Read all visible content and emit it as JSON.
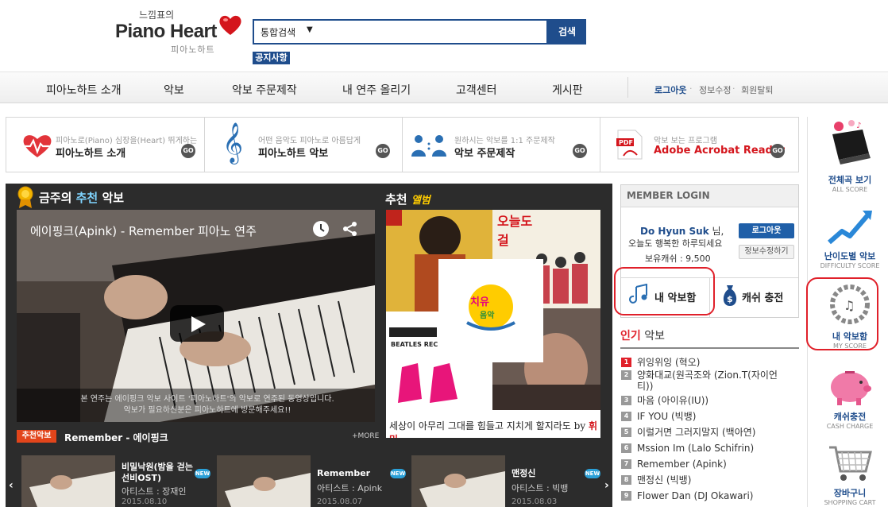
{
  "header": {
    "logo_sub": "느낌표의",
    "logo_main": "Piano Heart",
    "logo_kr": "피아노하트",
    "search_select": "통합검색",
    "search_button": "검색",
    "notice_button": "공지사항"
  },
  "nav": {
    "items": [
      "피아노하트 소개",
      "악보",
      "악보 주문제작",
      "내 연주 올리기",
      "고객센터",
      "게시판"
    ],
    "account": [
      "로그아웃",
      "정보수정",
      "회원탈퇴"
    ]
  },
  "banners": [
    {
      "small": "피아노로(Piano) 심장을(Heart) 뛰게하는",
      "big": "피아노하트 소개",
      "go": "GO"
    },
    {
      "small": "어떤 음악도 피아노로 아름답게",
      "big": "피아노하트 악보",
      "go": "GO"
    },
    {
      "small": "원하시는 악보를 1:1 주문제작",
      "big": "악보 주문제작",
      "go": "GO"
    },
    {
      "small": "악보 보는 프로그램",
      "big": "Adobe Acrobat Reader",
      "go": "GO"
    }
  ],
  "weekly": {
    "title_pre": "금주의 ",
    "title_hl": "추천",
    "title_post": " 악보",
    "video_title": "에이핑크(Apink) - Remember 피아노 연주",
    "caption_1": "본 연주는 에이핑크 악보 사이트 '피아노하트'의 악보로 연주된 동영상입니다.",
    "caption_2": "악보가 필요하신분은 피아노하트에 방문해주세요!!",
    "tag": "추천악보",
    "song": "Remember - 에이핑크",
    "more": "+MORE"
  },
  "rec_album": {
    "title": "추천 ",
    "title_hl": "앨범",
    "caption_a": "세상이 아무리 그대를 힘들고 지치게 할지라도 by ",
    "caption_b": "휘민"
  },
  "thumbs": [
    {
      "title": "비밀낙원(밤을 걷는 선비OST)",
      "artist": "아티스트 : 장재인",
      "date": "2015.08.10",
      "new": "NEW"
    },
    {
      "title": "Remember",
      "artist": "아티스트 : Apink",
      "date": "2015.08.07",
      "new": "NEW"
    },
    {
      "title": "맨정신",
      "artist": "아티스트 : 빅뱅",
      "date": "2015.08.03",
      "new": "NEW"
    }
  ],
  "login": {
    "head": "MEMBER LOGIN",
    "name": "Do Hyun Suk",
    "name_suffix": " 님,",
    "greet": "오늘도 행복한 하루되세요",
    "cash": "보유캐쉬 : 9,500",
    "logout": "로그아웃",
    "edit": "정보수정하기",
    "my_score": "내 악보함",
    "cash_charge": "캐쉬 충전"
  },
  "popular": {
    "title_hl": "인기",
    "title_rest": " 악보",
    "items": [
      {
        "rank": "1",
        "text": "위잉위잉 (혁오)"
      },
      {
        "rank": "2",
        "text": "양화대교(원곡조와 (Zion.T(자이언티))"
      },
      {
        "rank": "3",
        "text": "마음 (아이유(IU))"
      },
      {
        "rank": "4",
        "text": "IF YOU (빅뱅)"
      },
      {
        "rank": "5",
        "text": "이럴거면 그러지말지 (백아연)"
      },
      {
        "rank": "6",
        "text": "Mssion Im (Lalo Schifrin)"
      },
      {
        "rank": "7",
        "text": "Remember (Apink)"
      },
      {
        "rank": "8",
        "text": "맨정신 (빅뱅)"
      },
      {
        "rank": "9",
        "text": "Flower Dan (DJ Okawari)"
      }
    ]
  },
  "sidebar": [
    {
      "kr": "전체곡 보기",
      "en": "ALL SCORE"
    },
    {
      "kr": "난이도별 악보",
      "en": "DIFFICULTY SCORE"
    },
    {
      "kr": "내 악보함",
      "en": "MY SCORE"
    },
    {
      "kr": "캐쉬충전",
      "en": "CASH CHARGE"
    },
    {
      "kr": "장바구니",
      "en": "SHOPPING CART"
    }
  ],
  "colors": {
    "brand": "#1f4d8c",
    "accent_red": "#e0202a",
    "tag_orange": "#e2451b"
  }
}
